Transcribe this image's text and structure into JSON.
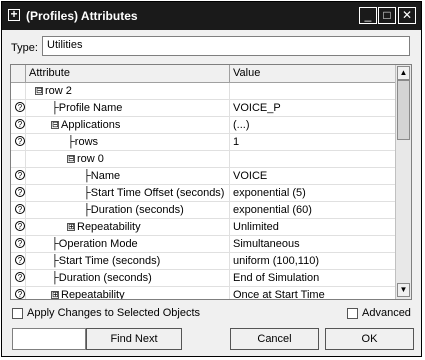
{
  "window": {
    "title": "(Profiles) Attributes",
    "icons": {
      "app": "plus-box-icon",
      "min": "minimize-icon",
      "max": "maximize-icon",
      "close": "close-icon"
    }
  },
  "type_field": {
    "label": "Type:",
    "value": "Utilities"
  },
  "grid": {
    "headers": {
      "attribute": "Attribute",
      "value": "Value"
    },
    "rows": [
      {
        "attribute": "row 2",
        "value": "",
        "help": false,
        "expander": "⊟"
      },
      {
        "attribute": "Profile Name",
        "value": "VOICE_P",
        "help": true,
        "expander": ""
      },
      {
        "attribute": "Applications",
        "value": "(...)",
        "help": true,
        "expander": "⊟"
      },
      {
        "attribute": "rows",
        "value": "1",
        "help": true,
        "expander": ""
      },
      {
        "attribute": "row 0",
        "value": "",
        "help": false,
        "expander": "⊟"
      },
      {
        "attribute": "Name",
        "value": "VOICE",
        "help": true,
        "expander": ""
      },
      {
        "attribute": "Start Time Offset (seconds)",
        "value": "exponential (5)",
        "help": true,
        "expander": ""
      },
      {
        "attribute": "Duration (seconds)",
        "value": "exponential (60)",
        "help": true,
        "expander": ""
      },
      {
        "attribute": "Repeatability",
        "value": "Unlimited",
        "help": true,
        "expander": "⊞"
      },
      {
        "attribute": "Operation Mode",
        "value": "Simultaneous",
        "help": true,
        "expander": ""
      },
      {
        "attribute": "Start Time (seconds)",
        "value": "uniform (100,110)",
        "help": true,
        "expander": ""
      },
      {
        "attribute": "Duration (seconds)",
        "value": "End of Simulation",
        "help": true,
        "expander": ""
      },
      {
        "attribute": "Repeatability",
        "value": "Once at Start Time",
        "help": true,
        "expander": "⊞"
      }
    ]
  },
  "footer": {
    "apply_label": "Apply Changes to Selected Objects",
    "advanced_label": "Advanced",
    "find_next_label": "Find Next",
    "cancel_label": "Cancel",
    "ok_label": "OK"
  }
}
